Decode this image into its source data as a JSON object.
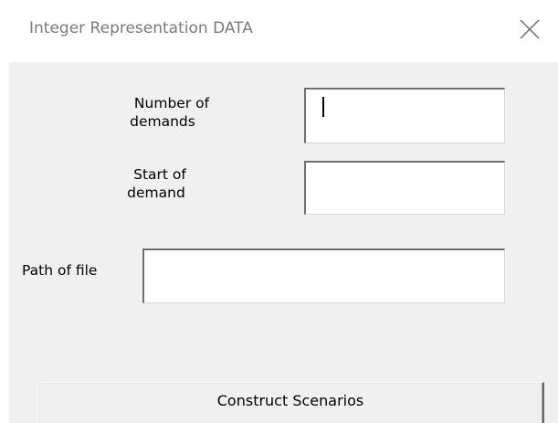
{
  "window": {
    "title": "Integer Representation DATA"
  },
  "form": {
    "number_of_demands_label_line1": "Number of",
    "number_of_demands_label_line2": "demands",
    "number_of_demands_value": "",
    "start_of_demand_label_line1": "Start of",
    "start_of_demand_label_line2": "demand",
    "start_of_demand_value": "",
    "path_of_file_label": "Path of file",
    "path_of_file_value": ""
  },
  "actions": {
    "construct_label": "Construct Scenarios"
  },
  "icons": {
    "close": "close-icon"
  },
  "colors": {
    "client_background": "#f0f0f0",
    "title_text": "#7a7a7a"
  }
}
